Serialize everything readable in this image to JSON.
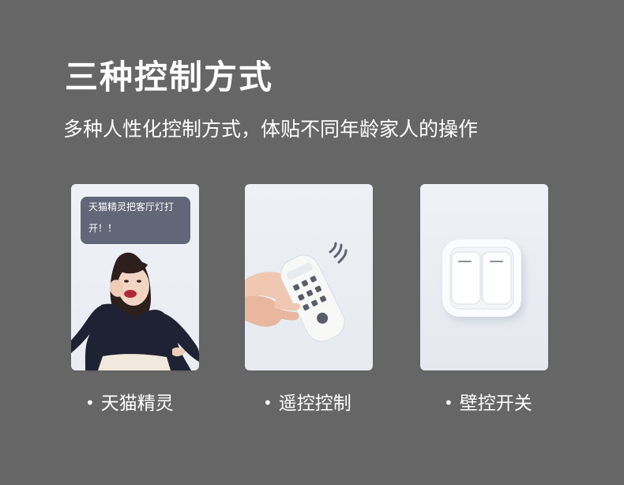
{
  "title": "三种控制方式",
  "subtitle": "多种人性化控制方式，体贴不同年龄家人的操作",
  "cards": [
    {
      "caption": "天猫精灵",
      "bubble": "天猫精灵把客厅灯打开！！"
    },
    {
      "caption": "遥控控制"
    },
    {
      "caption": "壁控开关"
    }
  ],
  "colors": {
    "background": "#666666",
    "text": "#ffffff",
    "bubble": "#616679",
    "card": "#eef1f5"
  }
}
